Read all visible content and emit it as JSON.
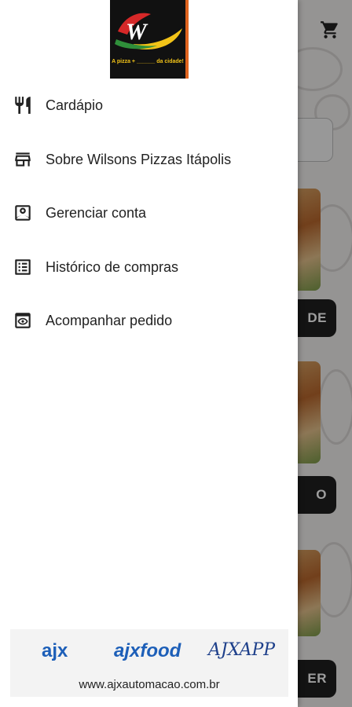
{
  "header": {
    "cart_icon": "cart-icon"
  },
  "background": {
    "buttons": [
      "DE",
      "O",
      "ER"
    ]
  },
  "logo": {
    "tagline": "A pizza + ______ da cidade!"
  },
  "drawer": {
    "items": [
      {
        "icon": "restaurant-icon",
        "label": "Cardápio"
      },
      {
        "icon": "store-icon",
        "label": "Sobre Wilsons Pizzas Itápolis"
      },
      {
        "icon": "account-box-icon",
        "label": "Gerenciar conta"
      },
      {
        "icon": "receipt-list-icon",
        "label": "Histórico de compras"
      },
      {
        "icon": "eye-icon",
        "label": "Acompanhar pedido"
      }
    ]
  },
  "footer": {
    "brands": [
      "ajx",
      "ajxfood",
      "AJXAPP"
    ],
    "url": "www.ajxautomacao.com.br"
  }
}
